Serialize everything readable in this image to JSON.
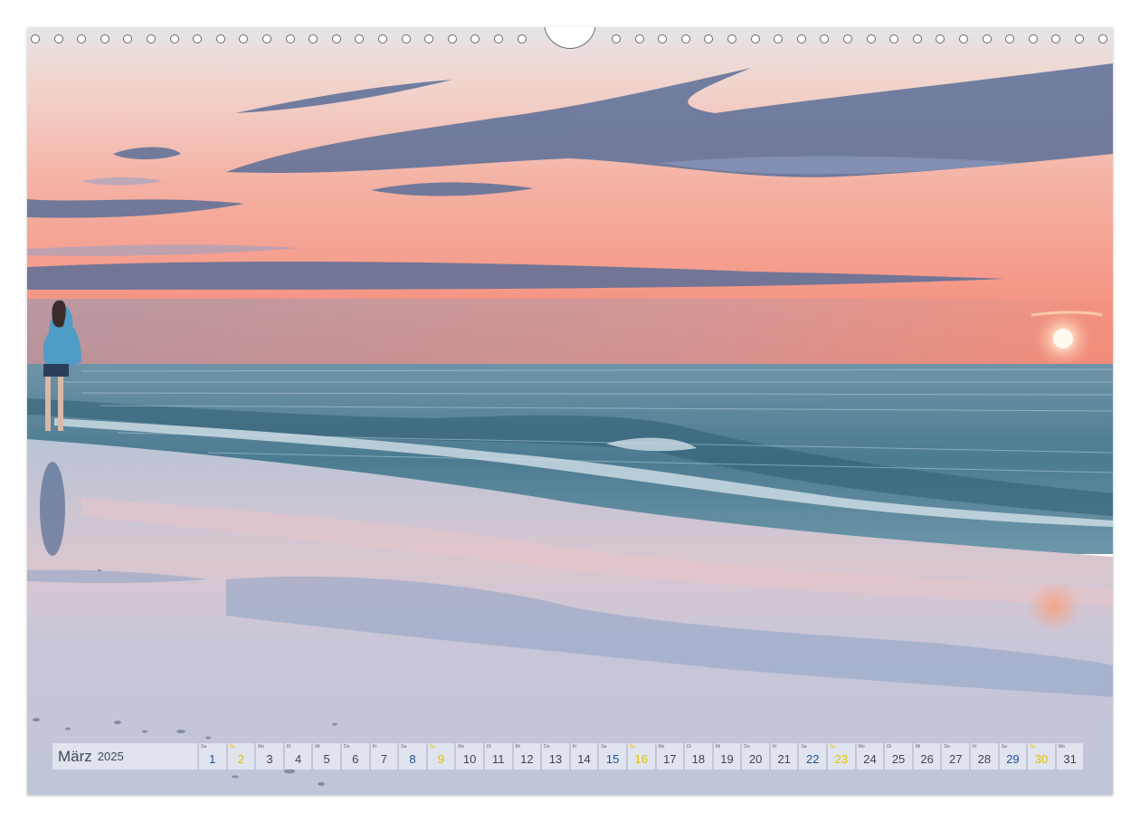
{
  "calendar": {
    "month": "März",
    "year": "2025",
    "days": [
      {
        "wd": "Sa",
        "num": "1",
        "type": "sat"
      },
      {
        "wd": "So",
        "num": "2",
        "type": "hol"
      },
      {
        "wd": "Mo",
        "num": "3",
        "type": ""
      },
      {
        "wd": "Di",
        "num": "4",
        "type": ""
      },
      {
        "wd": "Mi",
        "num": "5",
        "type": ""
      },
      {
        "wd": "Do",
        "num": "6",
        "type": ""
      },
      {
        "wd": "Fr",
        "num": "7",
        "type": ""
      },
      {
        "wd": "Sa",
        "num": "8",
        "type": "sat"
      },
      {
        "wd": "So",
        "num": "9",
        "type": "hol"
      },
      {
        "wd": "Mo",
        "num": "10",
        "type": ""
      },
      {
        "wd": "Di",
        "num": "11",
        "type": ""
      },
      {
        "wd": "Mi",
        "num": "12",
        "type": ""
      },
      {
        "wd": "Do",
        "num": "13",
        "type": ""
      },
      {
        "wd": "Fr",
        "num": "14",
        "type": ""
      },
      {
        "wd": "Sa",
        "num": "15",
        "type": "sat"
      },
      {
        "wd": "So",
        "num": "16",
        "type": "hol"
      },
      {
        "wd": "Mo",
        "num": "17",
        "type": ""
      },
      {
        "wd": "Di",
        "num": "18",
        "type": ""
      },
      {
        "wd": "Mi",
        "num": "19",
        "type": ""
      },
      {
        "wd": "Do",
        "num": "20",
        "type": ""
      },
      {
        "wd": "Fr",
        "num": "21",
        "type": ""
      },
      {
        "wd": "Sa",
        "num": "22",
        "type": "sat"
      },
      {
        "wd": "So",
        "num": "23",
        "type": "hol"
      },
      {
        "wd": "Mo",
        "num": "24",
        "type": ""
      },
      {
        "wd": "Di",
        "num": "25",
        "type": ""
      },
      {
        "wd": "Mi",
        "num": "26",
        "type": ""
      },
      {
        "wd": "Do",
        "num": "27",
        "type": ""
      },
      {
        "wd": "Fr",
        "num": "28",
        "type": ""
      },
      {
        "wd": "Sa",
        "num": "29",
        "type": "sat"
      },
      {
        "wd": "So",
        "num": "30",
        "type": "hol"
      },
      {
        "wd": "Mo",
        "num": "31",
        "type": ""
      }
    ]
  },
  "colors": {
    "sky_top": "#dfe3ea",
    "sky_pink": "#f3a49a",
    "horizon": "#f58a78",
    "sea": "#4e7f96",
    "sand": "#c9c9d8",
    "weekend_blue": "#1f4f97",
    "holiday_yellow": "#e0c100"
  },
  "photo": {
    "subject": "beach-sunset",
    "elements": [
      "sun-icon",
      "person-silhouette",
      "waves",
      "wet-sand-reflection"
    ]
  }
}
